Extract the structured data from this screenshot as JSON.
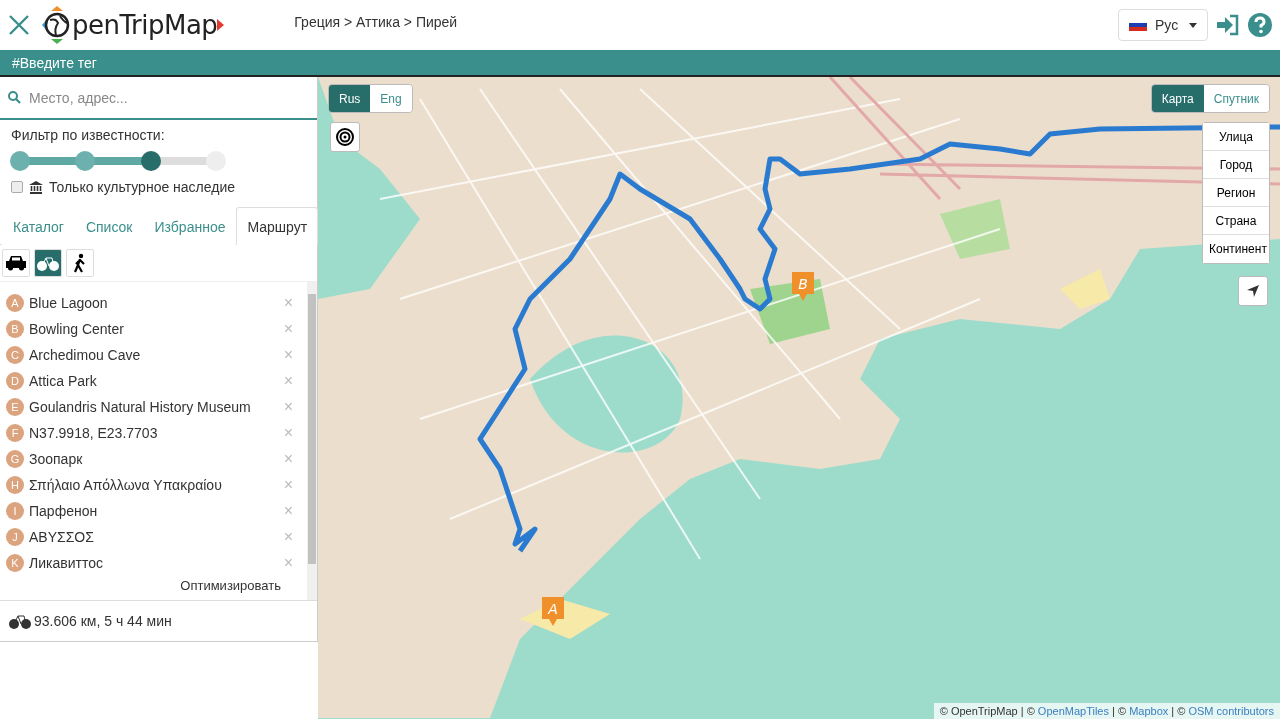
{
  "header": {
    "logo": "penTripMap",
    "breadcrumb": "Греция > Аттика > Пирей",
    "language": {
      "label": "Рус"
    }
  },
  "tag_bar": {
    "placeholder": "#Введите тег"
  },
  "sidebar": {
    "search": {
      "placeholder": "Место, адрес..."
    },
    "filter": {
      "label": "Фильтр по известности:",
      "level": 0.67
    },
    "heritage": {
      "label": "Только культурное наследие",
      "checked": false
    },
    "tabs": [
      {
        "label": "Каталог",
        "selected": false
      },
      {
        "label": "Список",
        "selected": false
      },
      {
        "label": "Избранное",
        "selected": false
      },
      {
        "label": "Маршрут",
        "selected": true
      }
    ],
    "modes": [
      {
        "kind": "car",
        "selected": false
      },
      {
        "kind": "bike",
        "selected": true
      },
      {
        "kind": "walk",
        "selected": false
      }
    ],
    "route_points": [
      {
        "letter": "A",
        "name": "Blue Lagoon",
        "remove": "×"
      },
      {
        "letter": "B",
        "name": "Bowling Center",
        "remove": "×"
      },
      {
        "letter": "C",
        "name": "Archedimou Cave",
        "remove": "×"
      },
      {
        "letter": "D",
        "name": "Attica Park",
        "remove": "×"
      },
      {
        "letter": "E",
        "name": "Goulandris Natural History Museum",
        "remove": "×"
      },
      {
        "letter": "F",
        "name": "N37.9918, E23.7703",
        "remove": "×"
      },
      {
        "letter": "G",
        "name": "Зоопарк",
        "remove": "×"
      },
      {
        "letter": "H",
        "name": "Σπήλαιο Απόλλωνα Υπακραίου",
        "remove": "×"
      },
      {
        "letter": "I",
        "name": "Парфенон",
        "remove": "×"
      },
      {
        "letter": "J",
        "name": "ΑΒΥΣΣΟΣ",
        "remove": "×"
      },
      {
        "letter": "K",
        "name": "Ликавиттос",
        "remove": "×"
      }
    ],
    "optimize": "Оптимизировать",
    "summary": "93.606 км, 5 ч 44 мин"
  },
  "map": {
    "languages": [
      {
        "label": "Rus",
        "selected": true
      },
      {
        "label": "Eng",
        "selected": false
      }
    ],
    "layers": [
      {
        "label": "Карта",
        "selected": true
      },
      {
        "label": "Спутник",
        "selected": false
      }
    ],
    "zoom_levels": [
      "Улица",
      "Город",
      "Регион",
      "Страна",
      "Континент"
    ],
    "markers": [
      {
        "letter": "A"
      },
      {
        "letter": "B"
      }
    ],
    "attribution": [
      {
        "text": "© OpenTripMap | © ",
        "kind": "text"
      },
      {
        "text": "OpenMapTiles",
        "kind": "link"
      },
      {
        "text": " | © ",
        "kind": "text"
      },
      {
        "text": "Mapbox",
        "kind": "link"
      },
      {
        "text": " | © ",
        "kind": "text"
      },
      {
        "text": "OSM contributors",
        "kind": "link"
      }
    ]
  }
}
